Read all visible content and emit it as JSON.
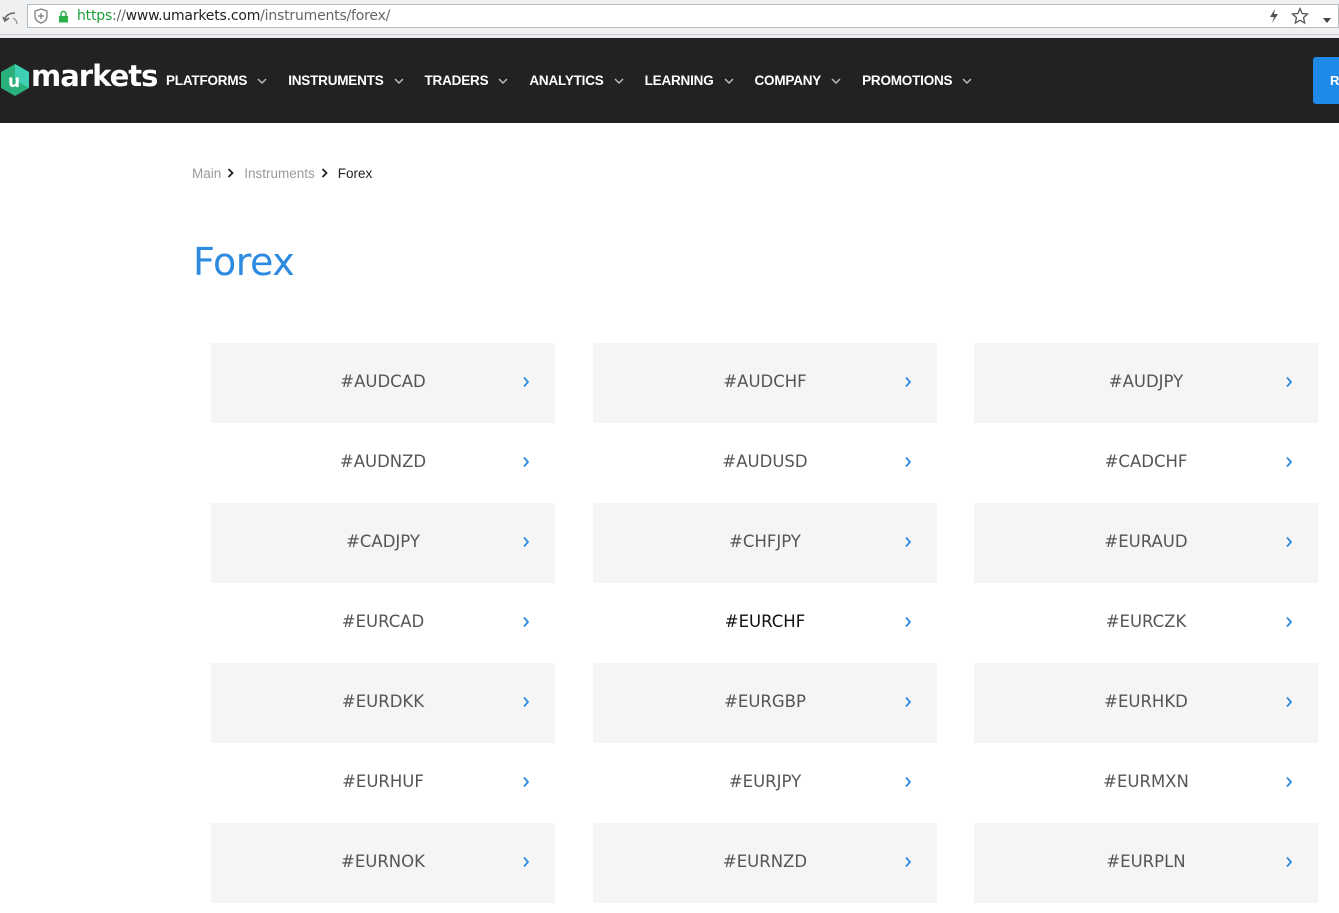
{
  "browser": {
    "url_scheme": "https",
    "url_sep": "://",
    "url_host": "www.umarkets.com",
    "url_path": "/instruments/forex/"
  },
  "site": {
    "logo_text": "markets",
    "logo_letter": "u",
    "nav": [
      {
        "label": "PLATFORMS"
      },
      {
        "label": "INSTRUMENTS"
      },
      {
        "label": "TRADERS"
      },
      {
        "label": "ANALYTICS"
      },
      {
        "label": "LEARNING"
      },
      {
        "label": "COMPANY"
      },
      {
        "label": "PROMOTIONS"
      }
    ],
    "cta_label": "R",
    "colors": {
      "nav_bg": "#222222",
      "accent": "#2c8be0",
      "logo_green": "#2bb07b"
    }
  },
  "breadcrumb": {
    "items": [
      "Main",
      "Instruments"
    ],
    "current": "Forex"
  },
  "page_title": "Forex",
  "instruments": [
    {
      "symbol": "#AUDCAD"
    },
    {
      "symbol": "#AUDCHF"
    },
    {
      "symbol": "#AUDJPY"
    },
    {
      "symbol": "#AUDNZD"
    },
    {
      "symbol": "#AUDUSD"
    },
    {
      "symbol": "#CADCHF"
    },
    {
      "symbol": "#CADJPY"
    },
    {
      "symbol": "#CHFJPY"
    },
    {
      "symbol": "#EURAUD"
    },
    {
      "symbol": "#EURCAD"
    },
    {
      "symbol": "#EURCHF"
    },
    {
      "symbol": "#EURCZK"
    },
    {
      "symbol": "#EURDKK"
    },
    {
      "symbol": "#EURGBP"
    },
    {
      "symbol": "#EURHKD"
    },
    {
      "symbol": "#EURHUF"
    },
    {
      "symbol": "#EURJPY"
    },
    {
      "symbol": "#EURMXN"
    },
    {
      "symbol": "#EURNOK"
    },
    {
      "symbol": "#EURNZD"
    },
    {
      "symbol": "#EURPLN"
    }
  ],
  "hovered_index": 10
}
